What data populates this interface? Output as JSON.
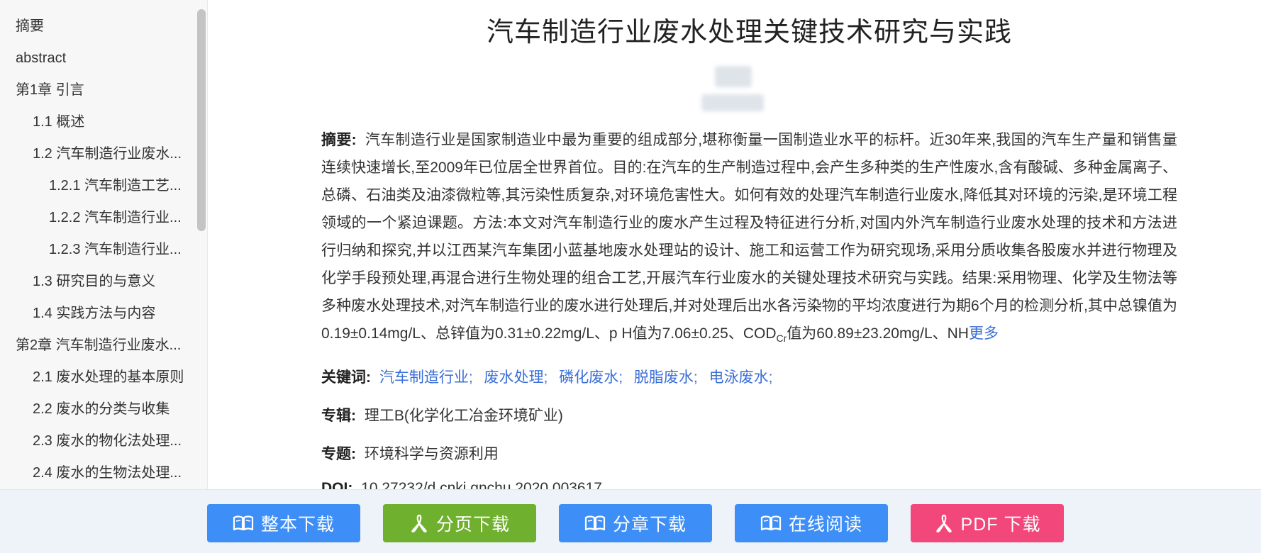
{
  "sidebar": {
    "items": [
      {
        "label": "摘要"
      },
      {
        "label": "abstract"
      },
      {
        "label": "第1章 引言"
      },
      {
        "label": "1.1 概述"
      },
      {
        "label": "1.2 汽车制造行业废水..."
      },
      {
        "label": "1.2.1 汽车制造工艺..."
      },
      {
        "label": "1.2.2 汽车制造行业..."
      },
      {
        "label": "1.2.3 汽车制造行业..."
      },
      {
        "label": "1.3 研究目的与意义"
      },
      {
        "label": "1.4 实践方法与内容"
      },
      {
        "label": "第2章 汽车制造行业废水..."
      },
      {
        "label": "2.1 废水处理的基本原则"
      },
      {
        "label": "2.2 废水的分类与收集"
      },
      {
        "label": "2.3 废水的物化法处理..."
      },
      {
        "label": "2.4 废水的生物法处理..."
      }
    ]
  },
  "paper": {
    "title": "汽车制造行业废水处理关键技术研究与实践",
    "abstract_label": "摘要:",
    "abstract_text": "汽车制造行业是国家制造业中最为重要的组成部分,堪称衡量一国制造业水平的标杆。近30年来,我国的汽车生产量和销售量连续快速增长,至2009年已位居全世界首位。目的:在汽车的生产制造过程中,会产生多种类的生产性废水,含有酸碱、多种金属离子、总磷、石油类及油漆微粒等,其污染性质复杂,对环境危害性大。如何有效的处理汽车制造行业废水,降低其对环境的污染,是环境工程领域的一个紧迫课题。方法:本文对汽车制造行业的废水产生过程及特征进行分析,对国内外汽车制造行业废水处理的技术和方法进行归纳和探究,并以江西某汽车集团小蓝基地废水处理站的设计、施工和运营工作为研究现场,采用分质收集各股废水并进行物理及化学手段预处理,再混合进行生物处理的组合工艺,开展汽车行业废水的关键处理技术研究与实践。结果:采用物理、化学及生物法等多种废水处理技术,对汽车制造行业的废水进行处理后,并对处理后出水各污染物的平均浓度进行为期6个月的检测分析,其中总镍值为0.19±0.14mg/L、总锌值为0.31±0.22mg/L、p H值为7.06±0.25、COD",
    "abstract_sub": "Cr",
    "abstract_tail": "值为60.89±23.20mg/L、NH",
    "more_label": "更多",
    "keywords_label": "关键词:",
    "keywords": [
      "汽车制造行业;",
      "废水处理;",
      "磷化废水;",
      "脱脂废水;",
      "电泳废水;"
    ],
    "album_label": "专辑:",
    "album_value": "理工B(化学化工冶金环境矿业)",
    "topic_label": "专题:",
    "topic_value": "环境科学与资源利用",
    "doi_label": "DOI:",
    "doi_value": "10.27232/d.cnki.gnchu.2020.003617"
  },
  "actions": {
    "full_download": "整本下载",
    "page_download": "分页下载",
    "chapter_download": "分章下载",
    "read_online": "在线阅读",
    "pdf_download": "PDF 下载"
  },
  "colors": {
    "blue_button": "#3d8ff7",
    "green_button": "#6fb02e",
    "pink_button": "#f1477a",
    "link": "#3b6fd8"
  },
  "icons": {
    "book": "book-icon",
    "acrobat": "pdf-icon"
  }
}
